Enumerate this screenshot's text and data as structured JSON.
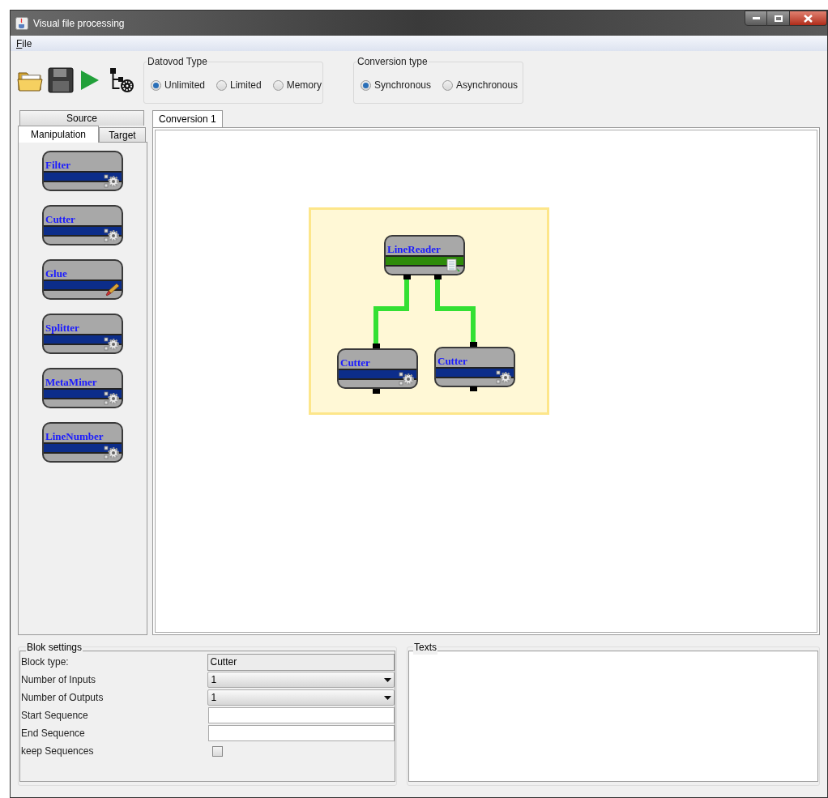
{
  "window": {
    "title": "Visual file processing"
  },
  "menu": [
    {
      "label": "File"
    }
  ],
  "datovod_type": {
    "title": "Datovod Type",
    "options": [
      {
        "label": "Unlimited",
        "selected": true
      },
      {
        "label": "Limited",
        "selected": false
      },
      {
        "label": "Memory",
        "selected": false
      }
    ]
  },
  "conversion_type": {
    "title": "Conversion type",
    "options": [
      {
        "label": "Synchronous",
        "selected": true
      },
      {
        "label": "Asynchronous",
        "selected": false
      }
    ]
  },
  "palette_tabs": [
    {
      "label": "Source",
      "selected": false
    },
    {
      "label": "Manipulation",
      "selected": true
    },
    {
      "label": "Target",
      "selected": false
    }
  ],
  "palette_blocks": [
    {
      "label": "Filter",
      "kind": "gear"
    },
    {
      "label": "Cutter",
      "kind": "gear"
    },
    {
      "label": "Glue",
      "kind": "glue"
    },
    {
      "label": "Splitter",
      "kind": "gear"
    },
    {
      "label": "MetaMiner",
      "kind": "gear"
    },
    {
      "label": "LineNumber",
      "kind": "gear"
    }
  ],
  "document_tabs": [
    {
      "label": "Conversion 1",
      "selected": true
    }
  ],
  "diagram": {
    "nodes": [
      {
        "label": "LineReader",
        "color": "#2e8b0a",
        "kind": "document"
      },
      {
        "label": "Cutter",
        "color": "#0c2d8a",
        "kind": "gear"
      },
      {
        "label": "Cutter",
        "color": "#0c2d8a",
        "kind": "gear"
      }
    ]
  },
  "block_settings": {
    "title": "Blok settings",
    "rows": [
      {
        "kind": "readonly",
        "label": "Block type:",
        "value": "Cutter"
      },
      {
        "kind": "dropdown",
        "label": "Number of Inputs",
        "value": "1"
      },
      {
        "kind": "dropdown",
        "label": "Number of Outputs",
        "value": "1"
      },
      {
        "kind": "input",
        "label": "Start Sequence"
      },
      {
        "kind": "input",
        "label": "End Sequence"
      },
      {
        "kind": "checkbox",
        "label": "keep Sequences",
        "checked": false
      }
    ]
  },
  "texts_panel": {
    "title": "Texts"
  }
}
